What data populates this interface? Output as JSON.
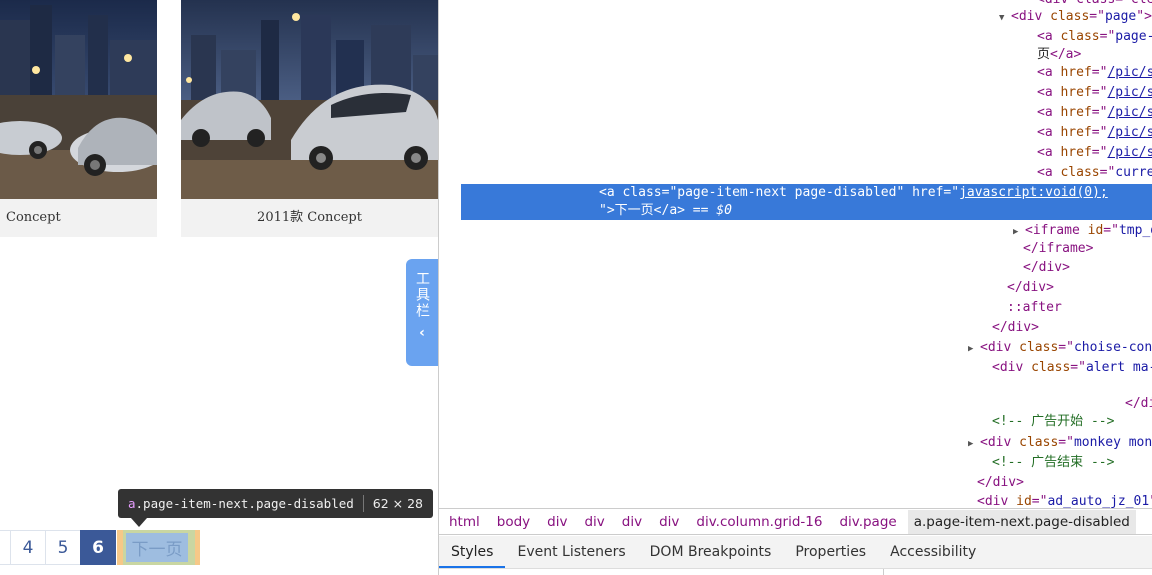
{
  "page": {
    "card1_caption": "Concept",
    "card2_caption": "2011款 Concept",
    "toolbar_label": "工具栏",
    "toolbar_arrow": "‹",
    "tooltip": {
      "tag": "a",
      "class": ".page-item-next.page-disabled",
      "size": "62 × 28"
    },
    "pager": [
      "4",
      "5",
      "6"
    ],
    "current_page": "6",
    "next_label": "下一页"
  },
  "devtools": {
    "lines": [
      {
        "indent": 0,
        "html": ""
      },
      {
        "tri": "open",
        "parts": [
          [
            "t",
            "<div "
          ],
          [
            "an",
            "class"
          ],
          [
            "t",
            "=\""
          ],
          [
            "av",
            "page"
          ],
          [
            "t",
            "\">"
          ]
        ]
      },
      {
        "parts": [
          [
            "t",
            "<a "
          ],
          [
            "an",
            "class"
          ],
          [
            "t",
            "=\""
          ],
          [
            "av",
            "page-item-prev"
          ],
          [
            "t",
            "\" "
          ],
          [
            "an",
            "href"
          ],
          [
            "t",
            "=\""
          ],
          [
            "lk",
            "/pic/series-t/2387-1-p5.html"
          ],
          [
            "t",
            "\">"
          ],
          [
            "tx",
            "上一"
          ]
        ]
      },
      {
        "parts": [
          [
            "tx",
            "页"
          ],
          [
            "t",
            "</a>"
          ]
        ]
      },
      {
        "parts": [
          [
            "t",
            "<a "
          ],
          [
            "an",
            "href"
          ],
          [
            "t",
            "=\""
          ],
          [
            "lk",
            "/pic/series-t/2387-1-p1.html"
          ],
          [
            "t",
            "\">"
          ],
          [
            "tx",
            "1"
          ],
          [
            "t",
            "</a>"
          ]
        ]
      },
      {
        "parts": [
          [
            "t",
            "<a "
          ],
          [
            "an",
            "href"
          ],
          [
            "t",
            "=\""
          ],
          [
            "lk",
            "/pic/series-t/2387-1-p2.html"
          ],
          [
            "t",
            "\">"
          ],
          [
            "tx",
            "2"
          ],
          [
            "t",
            "</a>"
          ]
        ]
      },
      {
        "parts": [
          [
            "t",
            "<a "
          ],
          [
            "an",
            "href"
          ],
          [
            "t",
            "=\""
          ],
          [
            "lk",
            "/pic/series-t/2387-1-p3.html"
          ],
          [
            "t",
            "\">"
          ],
          [
            "tx",
            "3"
          ],
          [
            "t",
            "</a>"
          ]
        ]
      },
      {
        "parts": [
          [
            "t",
            "<a "
          ],
          [
            "an",
            "href"
          ],
          [
            "t",
            "=\""
          ],
          [
            "lk",
            "/pic/series-t/2387-1-p4.html"
          ],
          [
            "t",
            "\">"
          ],
          [
            "tx",
            "4"
          ],
          [
            "t",
            "</a>"
          ]
        ]
      },
      {
        "parts": [
          [
            "t",
            "<a "
          ],
          [
            "an",
            "href"
          ],
          [
            "t",
            "=\""
          ],
          [
            "lk",
            "/pic/series-t/2387-1-p5.html"
          ],
          [
            "t",
            "\">"
          ],
          [
            "tx",
            "5"
          ],
          [
            "t",
            "</a>"
          ]
        ]
      },
      {
        "parts": [
          [
            "t",
            "<a "
          ],
          [
            "an",
            "class"
          ],
          [
            "t",
            "=\""
          ],
          [
            "av",
            "current"
          ],
          [
            "t",
            "\" "
          ],
          [
            "an",
            "href"
          ],
          [
            "t",
            "=\""
          ],
          [
            "lk",
            "javascript:void(0)"
          ],
          [
            "t",
            "\">"
          ],
          [
            "tx",
            "6"
          ],
          [
            "t",
            "</a>"
          ]
        ]
      },
      {
        "parts": [
          [
            "t",
            "<a "
          ],
          [
            "an",
            "class"
          ],
          [
            "t",
            "=\""
          ],
          [
            "av",
            "page-item-next  page-disabled"
          ],
          [
            "t",
            "\" "
          ],
          [
            "an",
            "href"
          ],
          [
            "t",
            "=\""
          ],
          [
            "lk",
            "javascript:void(0);"
          ]
        ]
      },
      {
        "parts": [
          [
            "t",
            "\">"
          ],
          [
            "tx",
            "下一页"
          ],
          [
            "t",
            "</a>"
          ],
          [
            "tx",
            " == "
          ],
          [
            "dl",
            "$0"
          ]
        ]
      },
      {
        "tri": "closed",
        "parts": [
          [
            "t",
            "<iframe "
          ],
          [
            "an",
            "id"
          ],
          [
            "t",
            "=\""
          ],
          [
            "av",
            "tmp_downloadhelper_iframe"
          ],
          [
            "t",
            "\" "
          ],
          [
            "an",
            "style"
          ],
          [
            "t",
            "=\""
          ],
          [
            "av",
            "display: none;"
          ],
          [
            "t",
            "\">…"
          ]
        ]
      },
      {
        "parts": [
          [
            "t",
            "</iframe>"
          ]
        ]
      },
      {
        "parts": [
          [
            "t",
            "</div>"
          ]
        ]
      },
      {
        "parts": [
          [
            "t",
            "</div>"
          ]
        ]
      },
      {
        "parts": [
          [
            "ps",
            "::after"
          ]
        ]
      },
      {
        "parts": [
          [
            "t",
            "</div>"
          ]
        ]
      },
      {
        "tri": "closed",
        "parts": [
          [
            "t",
            "<div "
          ],
          [
            "an",
            "class"
          ],
          [
            "t",
            "=\""
          ],
          [
            "av",
            "choise-cont ma-b-10"
          ],
          [
            "t",
            "\">…</div>"
          ]
        ]
      },
      {
        "parts": [
          [
            "t",
            "<div "
          ],
          [
            "an",
            "class"
          ],
          [
            "t",
            "=\""
          ],
          [
            "av",
            "alert ma-b-10"
          ],
          [
            "t",
            "\">"
          ]
        ]
      },
      {
        "parts": [
          [
            "t",
            "</div>"
          ]
        ]
      },
      {
        "parts": [
          [
            "cm",
            "<!-- 广告开始 -->"
          ]
        ]
      },
      {
        "tri": "closed",
        "parts": [
          [
            "t",
            "<div "
          ],
          [
            "an",
            "class"
          ],
          [
            "t",
            "=\""
          ],
          [
            "av",
            "monkey monkey_box "
          ],
          [
            "t",
            "\">…</div>"
          ]
        ]
      },
      {
        "parts": [
          [
            "cm",
            "<!-- 广告结束 -->"
          ]
        ]
      },
      {
        "parts": [
          [
            "t",
            "</div>"
          ]
        ]
      },
      {
        "parts": [
          [
            "t",
            "<div "
          ],
          [
            "an",
            "id"
          ],
          [
            "t",
            "=\""
          ],
          [
            "av",
            "ad_auto_jz_01"
          ],
          [
            "t",
            "\" "
          ],
          [
            "an",
            "style"
          ],
          [
            "t",
            "=\""
          ],
          [
            "av",
            "display: none"
          ],
          [
            "t",
            "\"></div>"
          ]
        ]
      }
    ],
    "top_partial": "<div class=\"clear\"></div>",
    "breadcrumbs": [
      "html",
      "body",
      "div",
      "div",
      "div",
      "div",
      "div.column.grid-16",
      "div.page",
      "a.page-item-next.page-disabled"
    ],
    "tabs": [
      "Styles",
      "Event Listeners",
      "DOM Breakpoints",
      "Properties",
      "Accessibility"
    ],
    "active_tab": "Styles",
    "selection_dots": "…"
  }
}
